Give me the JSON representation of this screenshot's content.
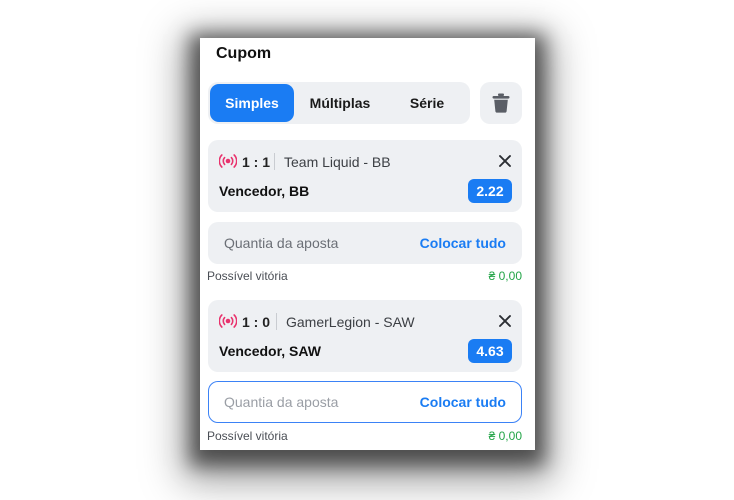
{
  "coupon": {
    "title": "Cupom",
    "tabs": [
      {
        "label": "Simples",
        "active": true
      },
      {
        "label": "Múltiplas",
        "active": false
      },
      {
        "label": "Série",
        "active": false
      }
    ],
    "trash_icon": "trash-icon",
    "bets": [
      {
        "live_icon": "live-broadcast-icon",
        "score": "1 : 1",
        "teams": "Team Liquid - BB",
        "market": "Vencedor, BB",
        "odds": "2.22",
        "stake_placeholder": "Quantia da aposta",
        "place_all": "Colocar tudo",
        "win_label": "Possível vitória",
        "win_value": "₴ 0,00"
      },
      {
        "live_icon": "live-broadcast-icon",
        "score": "1 : 0",
        "teams": "GamerLegion - SAW",
        "market": "Vencedor, SAW",
        "odds": "4.63",
        "stake_placeholder": "Quantia da aposta",
        "place_all": "Colocar tudo",
        "win_label": "Possível vitória",
        "win_value": "₴ 0,00"
      }
    ]
  },
  "colors": {
    "accent": "#1a7cf3",
    "live": "#e8336d",
    "win": "#22a447",
    "card_bg": "#eef0f3"
  }
}
